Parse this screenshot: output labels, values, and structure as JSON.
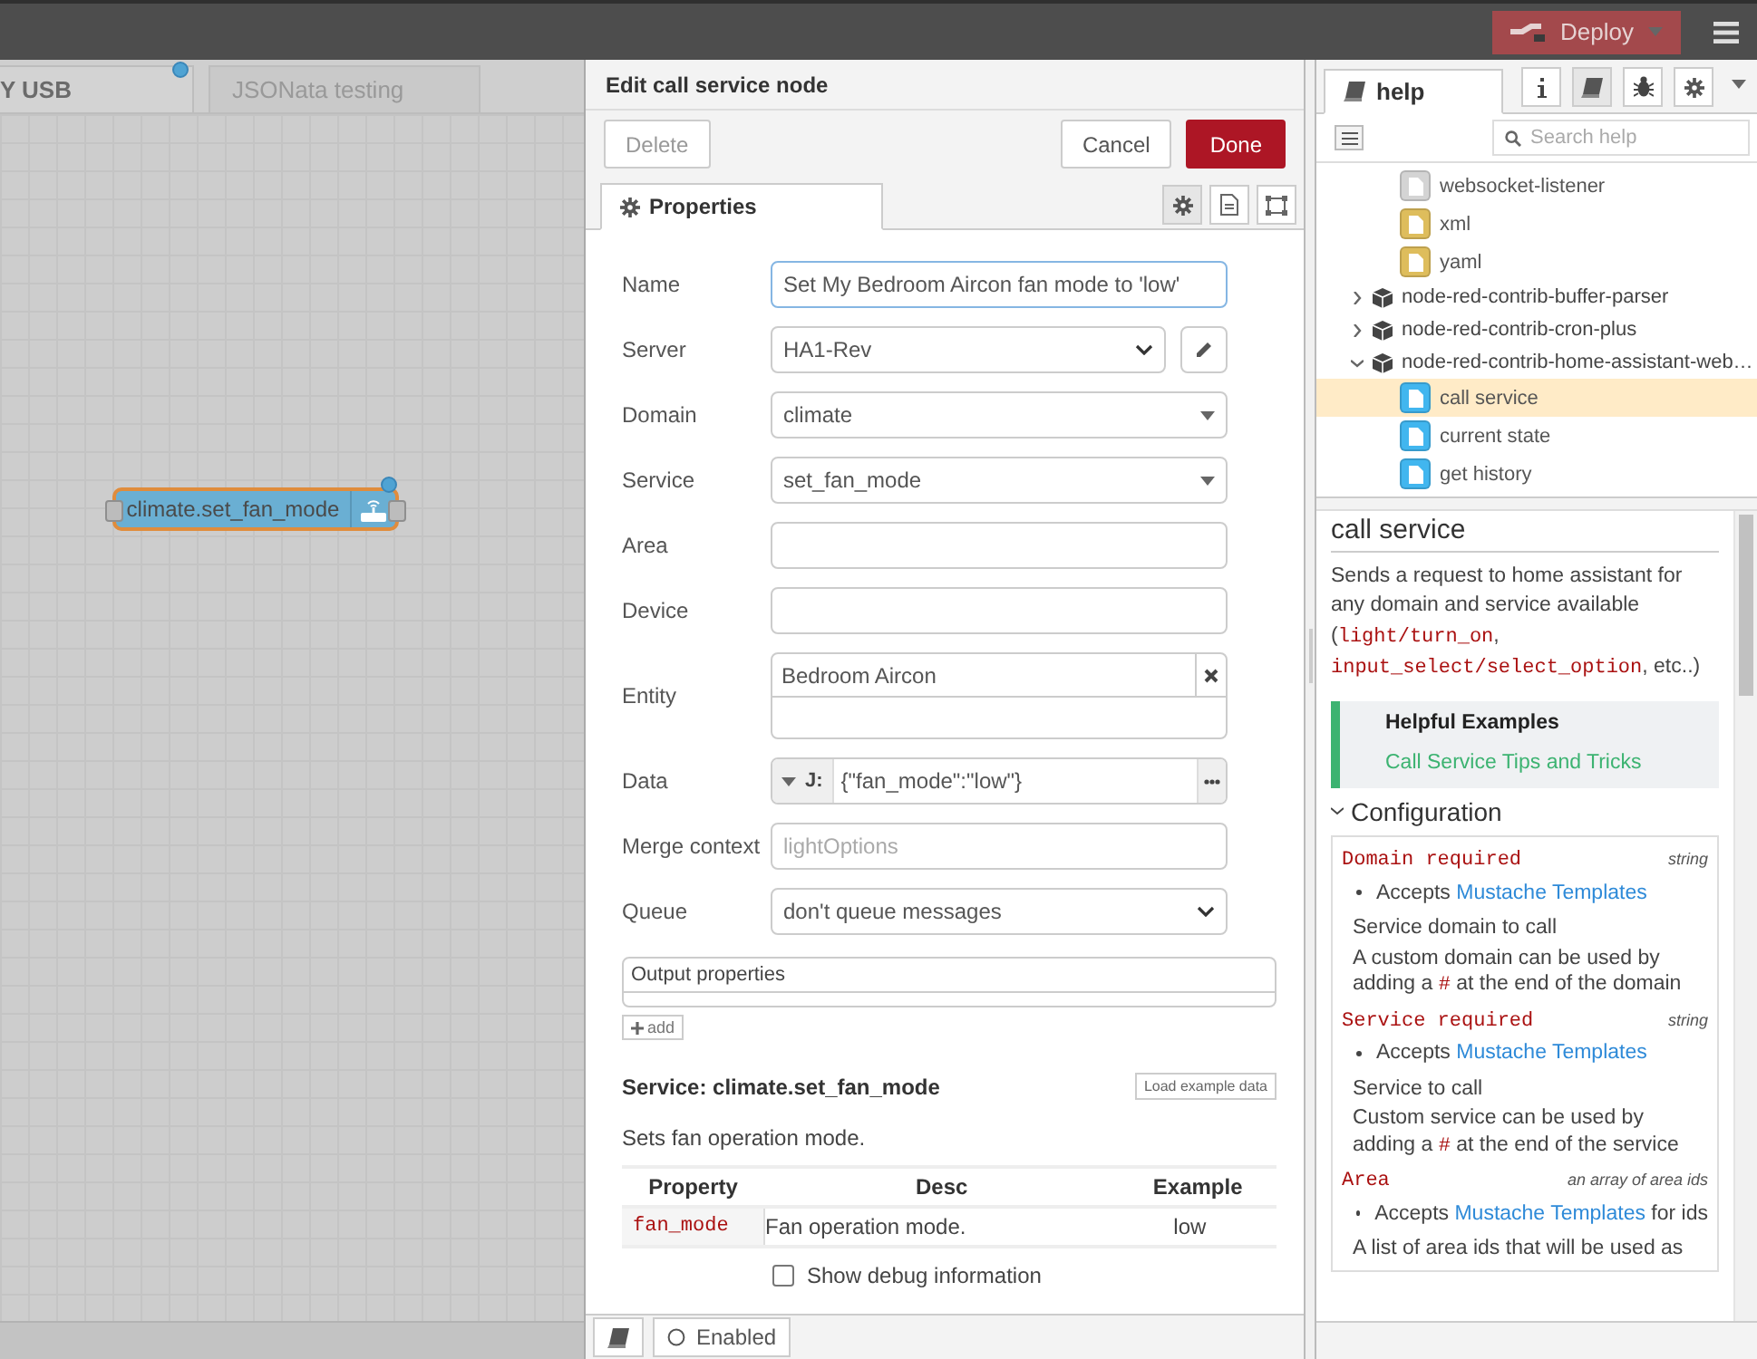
{
  "header": {
    "deploy": "Deploy"
  },
  "workspace": {
    "tabs": [
      {
        "label": "Y USB",
        "selected": true,
        "changed": true
      },
      {
        "label": "JSONata testing",
        "selected": false,
        "changed": false
      }
    ],
    "nodes": [
      {
        "label": "climate.set_fan_mode",
        "selected": true,
        "changed": true
      }
    ]
  },
  "editor": {
    "title": "Edit call service node",
    "buttons": {
      "delete": "Delete",
      "cancel": "Cancel",
      "done": "Done"
    },
    "tabs": [
      {
        "label": "Properties",
        "selected": true
      }
    ],
    "fields": [
      {
        "kind": "input",
        "label": "Name",
        "value": "Set My Bedroom Aircon fan mode to 'low'",
        "focused": true
      },
      {
        "kind": "select-edit",
        "label": "Server",
        "value": "HA1-Rev"
      },
      {
        "kind": "combo",
        "label": "Domain",
        "value": "climate"
      },
      {
        "kind": "combo",
        "label": "Service",
        "value": "set_fan_mode"
      },
      {
        "kind": "input",
        "label": "Area",
        "focused": false
      },
      {
        "kind": "input",
        "label": "Device",
        "focused": false
      },
      {
        "kind": "tags",
        "label": "Entity",
        "tags": [
          "Bedroom Aircon"
        ]
      },
      {
        "kind": "typed",
        "label": "Data",
        "type_label": "J:",
        "value": "{\"fan_mode\":\"low\"}"
      },
      {
        "kind": "input",
        "label": "Merge context",
        "placeholder": "lightOptions",
        "focused": false
      },
      {
        "kind": "select",
        "label": "Queue",
        "value": "don't queue messages"
      }
    ],
    "output_properties": {
      "title": "Output properties",
      "add": "add"
    },
    "service": {
      "heading": "Service: climate.set_fan_mode",
      "load_button": "Load example data",
      "description": "Sets fan operation mode.",
      "columns": [
        "Property",
        "Desc",
        "Example"
      ],
      "rows": [
        [
          "fan_mode",
          "Fan operation mode.",
          "low"
        ]
      ]
    },
    "debug": {
      "label": "Show debug information",
      "checked": false
    },
    "footer": {
      "enabled": "Enabled"
    }
  },
  "sidebar": {
    "tab": "help",
    "search": {
      "placeholder": "Search help"
    },
    "tree": [
      {
        "kind": "node",
        "label": "websocket-listener",
        "color": "#d4d4d4",
        "selected": false
      },
      {
        "kind": "node",
        "label": "xml",
        "color": "#debd5c",
        "selected": false
      },
      {
        "kind": "node",
        "label": "yaml",
        "color": "#debd5c",
        "selected": false
      },
      {
        "kind": "module",
        "label": "node-red-contrib-buffer-parser",
        "expanded": false
      },
      {
        "kind": "module",
        "label": "node-red-contrib-cron-plus",
        "expanded": false
      },
      {
        "kind": "module",
        "label": "node-red-contrib-home-assistant-web…",
        "expanded": true,
        "children": [
          {
            "kind": "node",
            "label": "call service",
            "color": "#41b6ef",
            "selected": true
          },
          {
            "kind": "node",
            "label": "current state",
            "color": "#41b6ef",
            "selected": false
          },
          {
            "kind": "node",
            "label": "get history",
            "color": "#41b6ef",
            "selected": false
          }
        ]
      }
    ],
    "help": {
      "title": "call service",
      "description": [
        {
          "text": "Sends a request to home assistant for any domain and service available (",
          "code": false
        },
        {
          "text": "light/turn_on",
          "code": true
        },
        {
          "text": ", ",
          "code": false
        },
        {
          "text": "input_select/select_option",
          "code": true
        },
        {
          "text": ", etc..)",
          "code": false
        }
      ],
      "examples": {
        "heading": "Helpful Examples",
        "link": "Call Service Tips and Tricks"
      },
      "section": {
        "title": "Configuration",
        "expanded": true
      },
      "config": [
        {
          "name": "Domain required",
          "type": "string",
          "bullet": [
            {
              "text": "Accepts ",
              "link": false
            },
            {
              "text": "Mustache Templates",
              "link": true
            }
          ],
          "lines": [
            [
              {
                "text": "Service domain to call",
                "code": false
              }
            ],
            [
              {
                "text": "A custom domain can be used by adding a ",
                "code": false
              },
              {
                "text": "#",
                "code": true
              },
              {
                "text": " at the end of the domain",
                "code": false
              }
            ]
          ]
        },
        {
          "name": "Service required",
          "type": "string",
          "bullet": [
            {
              "text": "Accepts ",
              "link": false
            },
            {
              "text": "Mustache Templates",
              "link": true
            }
          ],
          "lines": [
            [
              {
                "text": "Service to call",
                "code": false
              }
            ],
            [
              {
                "text": "Custom service can be used by adding a ",
                "code": false
              },
              {
                "text": "#",
                "code": true
              },
              {
                "text": " at the end of the service",
                "code": false
              }
            ]
          ]
        },
        {
          "name": "Area",
          "type": "an array of area ids",
          "bullet": [
            {
              "text": "Accepts ",
              "link": false
            },
            {
              "text": "Mustache Templates",
              "link": true
            },
            {
              "text": " for ids",
              "link": false
            }
          ],
          "lines": [
            [
              {
                "text": "A list of area ids that will be used as",
                "code": false
              }
            ]
          ]
        }
      ]
    }
  }
}
